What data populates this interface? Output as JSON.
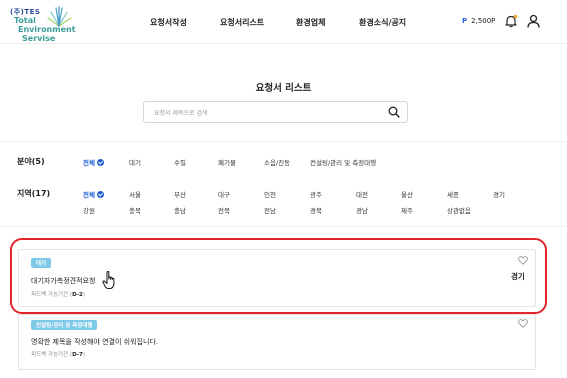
{
  "header": {
    "logo": {
      "line1": "(주)TES",
      "line2": "Total",
      "line3": "Environment",
      "line4": "Servise"
    },
    "nav": [
      "요청서작성",
      "요청서리스트",
      "환경업체",
      "환경소식/공지"
    ],
    "points_symbol": "P",
    "points_value": "2,500P"
  },
  "page": {
    "title": "요청서 리스트",
    "search_placeholder": "요청서 제목으로 검색"
  },
  "filters": {
    "field": {
      "label": "분야(5)",
      "options": [
        "전체",
        "대기",
        "수질",
        "폐기물",
        "소음/진동",
        "컨설팅/관리 및 측정대행"
      ],
      "selected": "전체"
    },
    "region": {
      "label": "지역(17)",
      "row1": [
        "전체",
        "서울",
        "부산",
        "대구",
        "인천",
        "광주",
        "대전",
        "울산",
        "세종",
        "경기"
      ],
      "row2": [
        "강원",
        "충북",
        "충남",
        "전북",
        "전남",
        "경북",
        "경남",
        "제주",
        "상관없음"
      ],
      "selected": "전체"
    }
  },
  "cards": [
    {
      "tag": "대기",
      "title": "대기자가측정견적요청",
      "meta_prefix": "피드백 가능기간 (",
      "meta_value": "D-2",
      "meta_suffix": ")",
      "region": "경기"
    },
    {
      "tag": "컨설팅/관리 및 측정대행",
      "title": "명확한 제목을 작성해야 연결이 쉬워집니다.",
      "meta_prefix": "피드백 가능기간 (",
      "meta_value": "D-7",
      "meta_suffix": ")",
      "region": ""
    }
  ],
  "colors": {
    "accent": "#1f5fd0",
    "tag": "#7ec8e8",
    "highlight": "#e0262b"
  }
}
